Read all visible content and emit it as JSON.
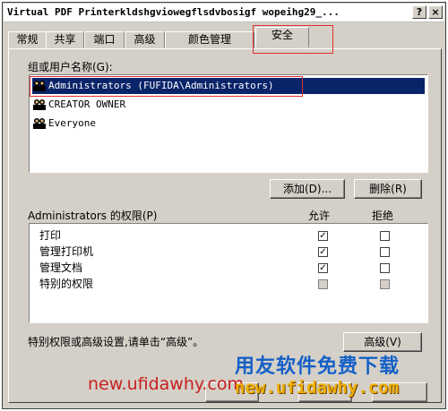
{
  "window": {
    "title": "Virtual PDF Printerkldshgviowegflsdvbosigf wopeihg29_..."
  },
  "titlebar": {
    "help": "?",
    "close": "×"
  },
  "tabs": [
    {
      "label": "常规"
    },
    {
      "label": "共享"
    },
    {
      "label": "端口"
    },
    {
      "label": "高级"
    },
    {
      "label": "颜色管理"
    },
    {
      "label": "安全"
    }
  ],
  "groups": {
    "label": "组或用户名称(G):",
    "users": [
      {
        "name": "Administrators (FUFIDA\\Administrators)",
        "selected": true
      },
      {
        "name": "CREATOR OWNER",
        "selected": false
      },
      {
        "name": "Everyone",
        "selected": false
      }
    ],
    "add_label": "添加(D)...",
    "remove_label": "删除(R)"
  },
  "permissions": {
    "label": "Administrators 的权限(P)",
    "allow_header": "允许",
    "deny_header": "拒绝",
    "rows": [
      {
        "name": "打印",
        "allow": true,
        "deny": false,
        "disabled": false
      },
      {
        "name": "管理打印机",
        "allow": true,
        "deny": false,
        "disabled": false
      },
      {
        "name": "管理文档",
        "allow": true,
        "deny": false,
        "disabled": false
      },
      {
        "name": "特别的权限",
        "allow": false,
        "deny": false,
        "disabled": true
      }
    ]
  },
  "advanced": {
    "hint": "特别权限或高级设置,请单击“高级”。",
    "button_label": "高级(V)"
  },
  "watermark": {
    "cn": "用友软件免费下载",
    "url_red": "new.ufidawhy.com",
    "url_yellow": "new.ufidawhy.com"
  },
  "colors": {
    "selection": "#0a246a",
    "dialog": "#d4d0c8",
    "highlight": "#e03030"
  }
}
